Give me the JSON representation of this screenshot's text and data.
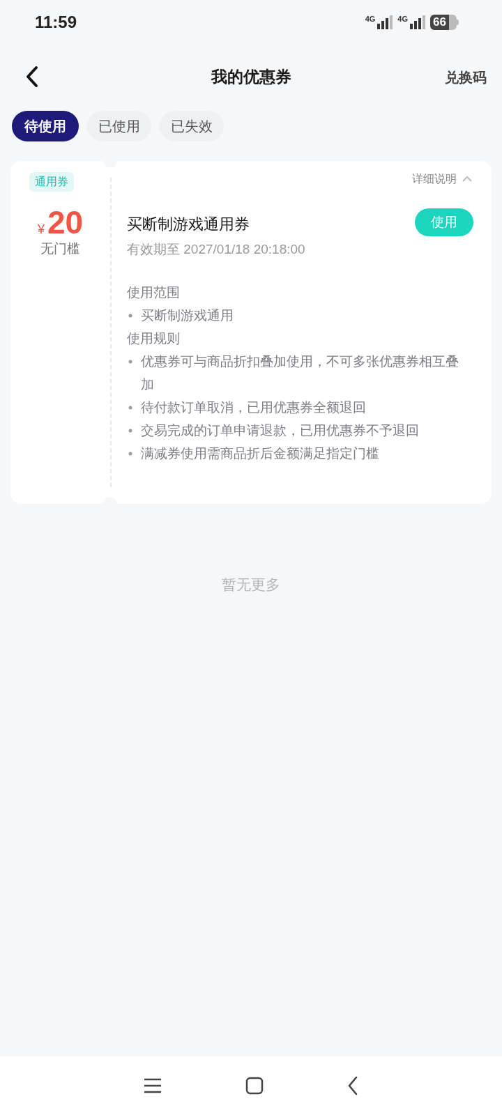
{
  "status_bar": {
    "time": "11:59",
    "network_1": "4G",
    "network_2": "4G",
    "battery": "66"
  },
  "header": {
    "title": "我的优惠券",
    "action": "兑换码"
  },
  "tabs": [
    {
      "label": "待使用",
      "selected": true
    },
    {
      "label": "已使用",
      "selected": false
    },
    {
      "label": "已失效",
      "selected": false
    }
  ],
  "coupons": [
    {
      "tag": "通用券",
      "currency": "¥",
      "amount": "20",
      "threshold": "无门槛",
      "details_label": "详细说明",
      "expanded": true,
      "name": "买断制游戏通用券",
      "validity": "有效期至 2027/01/18 20:18:00",
      "button": "使用",
      "sections": [
        {
          "title": "使用范围",
          "items": [
            "买断制游戏通用"
          ]
        },
        {
          "title": "使用规则",
          "items": [
            "优惠券可与商品折扣叠加使用，不可多张优惠券相互叠加",
            "待付款订单取消，已用优惠券全额退回",
            "交易完成的订单申请退款，已用优惠券不予退回",
            "满减券使用需商品折后金额满足指定门槛"
          ]
        }
      ]
    }
  ],
  "footer_note": "暂无更多"
}
